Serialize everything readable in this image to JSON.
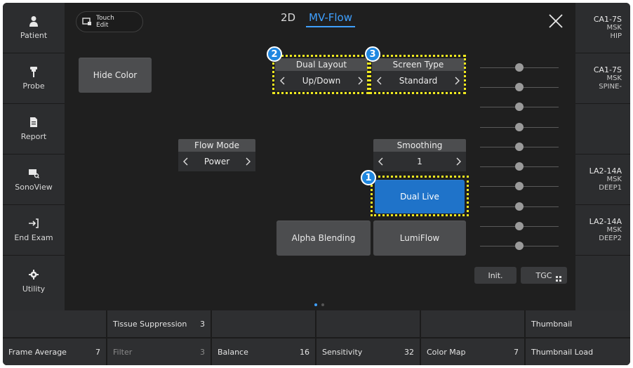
{
  "sidebar": {
    "items": [
      {
        "label": "Patient",
        "icon": "patient-icon"
      },
      {
        "label": "Probe",
        "icon": "probe-icon"
      },
      {
        "label": "Report",
        "icon": "report-icon"
      },
      {
        "label": "SonoView",
        "icon": "sonoview-icon"
      },
      {
        "label": "End Exam",
        "icon": "end-exam-icon"
      },
      {
        "label": "Utility",
        "icon": "gear-icon"
      }
    ]
  },
  "header": {
    "touch_edit_line1": "Touch",
    "touch_edit_line2": "Edit",
    "tab_2d": "2D",
    "tab_mvflow": "MV-Flow",
    "accent_color": "#3fa0ff"
  },
  "controls": {
    "hide_color": "Hide Color",
    "dual_layout": {
      "label": "Dual Layout",
      "value": "Up/Down"
    },
    "screen_type": {
      "label": "Screen Type",
      "value": "Standard"
    },
    "flow_mode": {
      "label": "Flow Mode",
      "value": "Power"
    },
    "smoothing": {
      "label": "Smoothing",
      "value": "1"
    },
    "dual_live": "Dual Live",
    "alpha_blending": "Alpha Blending",
    "lumiflow": "LumiFlow",
    "init": "Init.",
    "tgc": "TGC"
  },
  "annotations": {
    "badge1": "1",
    "badge2": "2",
    "badge3": "3",
    "highlight_color": "#f1ea1f"
  },
  "probes": [
    {
      "model": "CA1-7S",
      "line2": "MSK",
      "line3": "HIP"
    },
    {
      "model": "CA1-7S",
      "line2": "MSK",
      "line3": "SPINE-"
    },
    {
      "model": "",
      "line2": "",
      "line3": ""
    },
    {
      "model": "LA2-14A",
      "line2": "MSK",
      "line3": "DEEP1"
    },
    {
      "model": "LA2-14A",
      "line2": "MSK",
      "line3": "DEEP2"
    },
    {
      "model": "",
      "line2": "",
      "line3": ""
    }
  ],
  "bottom": {
    "row1": [
      {
        "label": "",
        "value": ""
      },
      {
        "label": "Tissue Suppression",
        "value": "3"
      },
      {
        "label": "",
        "value": ""
      },
      {
        "label": "",
        "value": ""
      },
      {
        "label": "",
        "value": ""
      },
      {
        "label": "Thumbnail",
        "value": ""
      }
    ],
    "row2": [
      {
        "label": "Frame Average",
        "value": "7"
      },
      {
        "label": "Filter",
        "value": "3"
      },
      {
        "label": "Balance",
        "value": "16"
      },
      {
        "label": "Sensitivity",
        "value": "32"
      },
      {
        "label": "Color Map",
        "value": "7"
      },
      {
        "label": "Thumbnail Load",
        "value": ""
      }
    ]
  },
  "pagination": {
    "pages": 2,
    "current": 1
  }
}
